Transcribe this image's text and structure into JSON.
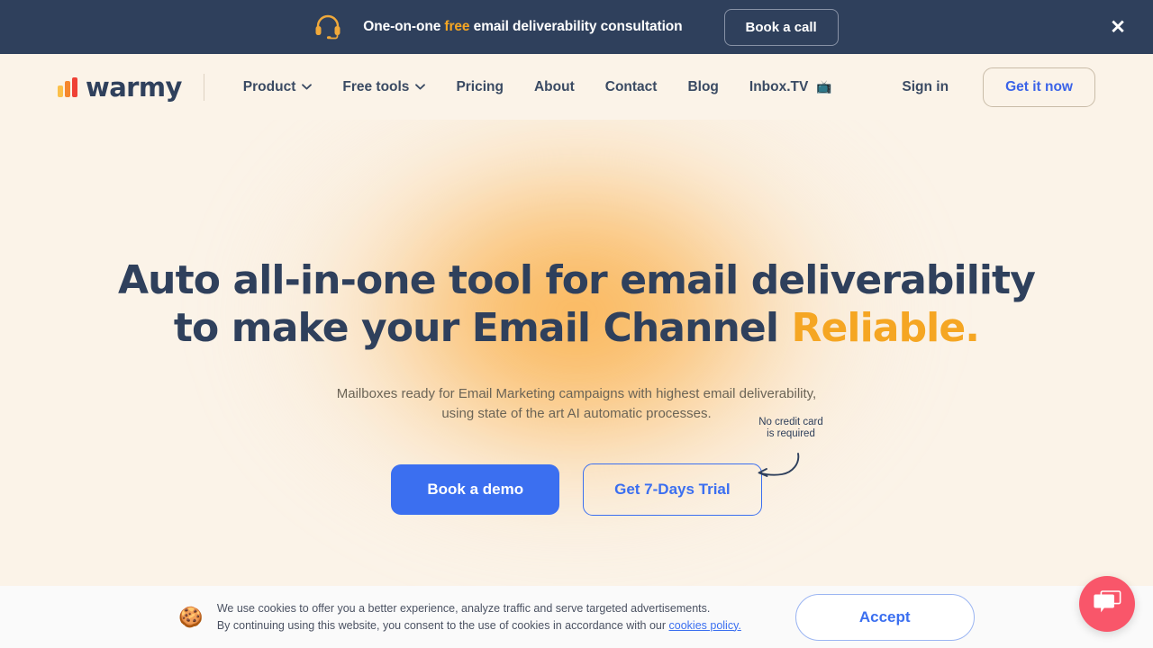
{
  "promo_banner": {
    "icon": "headset-icon",
    "text_before": "One-on-one ",
    "text_highlight": "free",
    "text_after": " email deliverability consultation",
    "cta_label": "Book a call",
    "close_label": "✕",
    "background_color": "#2F405C",
    "highlight_color": "#F5A623"
  },
  "navbar": {
    "logo_text": "warmy",
    "logo_bar_colors": [
      "#FBC04A",
      "#F5872E",
      "#EF4136"
    ],
    "links": [
      {
        "label": "Product",
        "has_dropdown": true
      },
      {
        "label": "Free tools",
        "has_dropdown": true
      },
      {
        "label": "Pricing",
        "has_dropdown": false
      },
      {
        "label": "About",
        "has_dropdown": false
      },
      {
        "label": "Contact",
        "has_dropdown": false
      },
      {
        "label": "Blog",
        "has_dropdown": false
      },
      {
        "label": "Inbox.TV",
        "has_dropdown": false,
        "emoji": "📺"
      }
    ],
    "sign_in_label": "Sign in",
    "get_it_now_label": "Get it now",
    "accent_color": "#3B63E8"
  },
  "hero": {
    "title_line1": "Auto all-in-one tool for email deliverability",
    "title_line2_plain": "to make your Email Channel ",
    "title_line2_accent": "Reliable.",
    "subtitle_line1": "Mailboxes ready for Email Marketing campaigns with highest email deliverability,",
    "subtitle_line2": "using state of the art AI automatic processes.",
    "primary_cta": "Book a demo",
    "secondary_cta": "Get 7-Days Trial",
    "note_line1": "No credit card",
    "note_line2": "is required",
    "title_color": "#2F405C",
    "accent_color": "#F5A623",
    "primary_cta_color": "#3B6FF0",
    "background_color": "#FBF3E8"
  },
  "cookie_banner": {
    "icon": "🍪",
    "line1": "We use cookies to offer you a better experience, analyze traffic and serve targeted advertisements.",
    "line2_before": "By continuing using this website, you consent to the use of cookies in accordance with our ",
    "line2_link": "cookies policy.",
    "accept_label": "Accept",
    "background_color": "#FAFAFA",
    "link_color": "#3B6FF0"
  },
  "chat_widget": {
    "icon": "chat-bubble-icon",
    "color": "#F9566A"
  }
}
